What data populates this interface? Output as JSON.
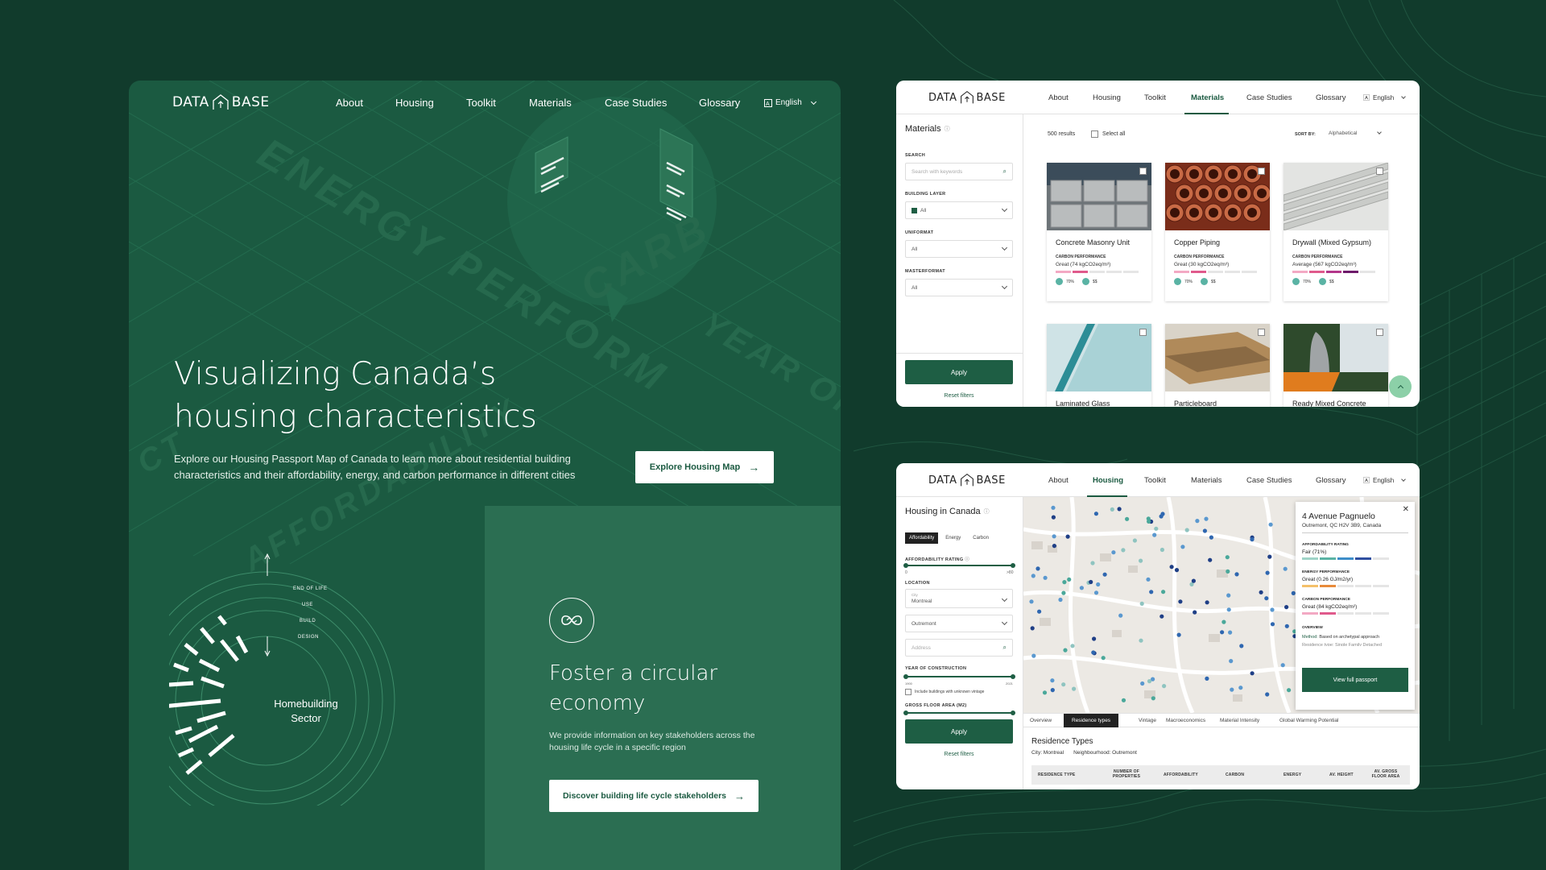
{
  "brand": {
    "left": "DATA",
    "right": "BASE"
  },
  "nav": {
    "about": "About",
    "housing": "Housing",
    "toolkit": "Toolkit",
    "materials": "Materials",
    "case_studies": "Case Studies",
    "glossary": "Glossary",
    "language": "English"
  },
  "hero": {
    "title_line1": "Visualizing Canada’s",
    "title_line2": "housing characteristics",
    "description_line1": "Explore our Housing Passport Map of Canada to learn more about residential building",
    "description_line2": "characteristics and their affordability, energy, and carbon performance in different cities",
    "cta": "Explore Housing Map",
    "bg_words": [
      "ENERGY PERFORM",
      "CARB",
      "AFFORDABILITY",
      "YEAR OF",
      "CT"
    ],
    "rack_left": [
      "AFFORDABILITY RATING",
      "ENERGY PERFORMANCE"
    ],
    "rack_right": [
      "AFFORDABILITY RATING",
      "ENERGY PERFORMANCE",
      "CARBON PERFORMANCE"
    ]
  },
  "wheel": {
    "center_line1": "Homebuilding",
    "center_line2": "Sector",
    "stages": [
      "END OF LIFE",
      "USE",
      "BUILD",
      "DESIGN"
    ]
  },
  "circular": {
    "title_line1": "Foster a circular",
    "title_line2": "economy",
    "desc_line1": "We provide information on key stakeholders across the",
    "desc_line2": "housing life cycle in a specific region",
    "cta": "Discover building life cycle stakeholders"
  },
  "materials_screen": {
    "title": "Materials",
    "results": "500 results",
    "select_all": "Select all",
    "sort_label": "SORT BY:",
    "sort_value": "Alphabetical",
    "filters": {
      "search_label": "SEARCH",
      "search_placeholder": "Search with keywords",
      "layer_label": "BUILDING LAYER",
      "layer_value": "All",
      "uniformat_label": "UNIFORMAT",
      "uniformat_value": "All",
      "masterformat_label": "MASTERFORMAT",
      "masterformat_value": "All"
    },
    "apply": "Apply",
    "reset": "Reset filters",
    "carbon_label": "CARBON PERFORMANCE",
    "cards": [
      {
        "name": "Concrete Masonry Unit",
        "carbon": "Great (74 kgCO2eq/m³)",
        "pct": "70%",
        "cost": "$$"
      },
      {
        "name": "Copper Piping",
        "carbon": "Great (30 kgCO2eq/m³)",
        "pct": "70%",
        "cost": "$$"
      },
      {
        "name": "Drywall (Mixed Gypsum)",
        "carbon": "Average (567 kgCO2eq/m³)",
        "pct": "70%",
        "cost": "$$"
      },
      {
        "name": "Laminated Glass"
      },
      {
        "name": "Particleboard"
      },
      {
        "name": "Ready Mixed Concrete"
      }
    ]
  },
  "housing_screen": {
    "title": "Housing in Canada",
    "tabs": [
      "Affordability",
      "Energy",
      "Carbon"
    ],
    "aff_label": "AFFORDABILITY RATING",
    "aff_min": "0",
    "aff_max": ">80",
    "location_label": "LOCATION",
    "city_small": "City",
    "city": "Montreal",
    "neighbourhood": "Outremont",
    "address_placeholder": "Address",
    "year_label": "YEAR OF CONSTRUCTION",
    "year_min": "1900",
    "year_max": "2021",
    "unknown_vintage": "Include buildings with unknown vintage",
    "gfa_label": "GROSS FLOOR AREA (M2)",
    "apply": "Apply",
    "reset": "Reset filters",
    "popup": {
      "title": "4 Avenue Pagnuelo",
      "address": "Outremont, QC H2V 3B9, Canada",
      "aff_label": "AFFORDABILITY RATING",
      "aff_value": "Fair (71%)",
      "energy_label": "ENERGY PERFORMANCE",
      "energy_value": "Great (0.26 GJ/m2/yr)",
      "carbon_label": "CARBON PERFORMANCE",
      "carbon_value": "Great (84 kgCO2eq/m²)",
      "overview_label": "OVERVIEW",
      "method_key": "Method:",
      "method_value": "Based on archetypal approach",
      "residence_peek": "Residence type:  Single Family Detached",
      "button": "View full passport"
    },
    "bottom_tabs": [
      "Overview",
      "Residence types",
      "Vintage",
      "Macroeconomics",
      "Material Intensity",
      "Global Warming Potential"
    ],
    "section_title": "Residence Types",
    "city_line": "City: Montreal",
    "neigh_line": "Neighbourhood: Outremont",
    "table_headers": [
      "RESIDENCE TYPE",
      "NUMBER OF PROPERTIES",
      "AFFORDABILITY",
      "CARBON",
      "ENERGY",
      "AV. HEIGHT",
      "AV. GROSS FLOOR AREA"
    ]
  },
  "colors": {
    "page_bg": "#113b2c",
    "hero": "#1b5a41",
    "accent": "#1e5e44",
    "pink": "#e05a8c",
    "blue": "#2f67b0"
  }
}
